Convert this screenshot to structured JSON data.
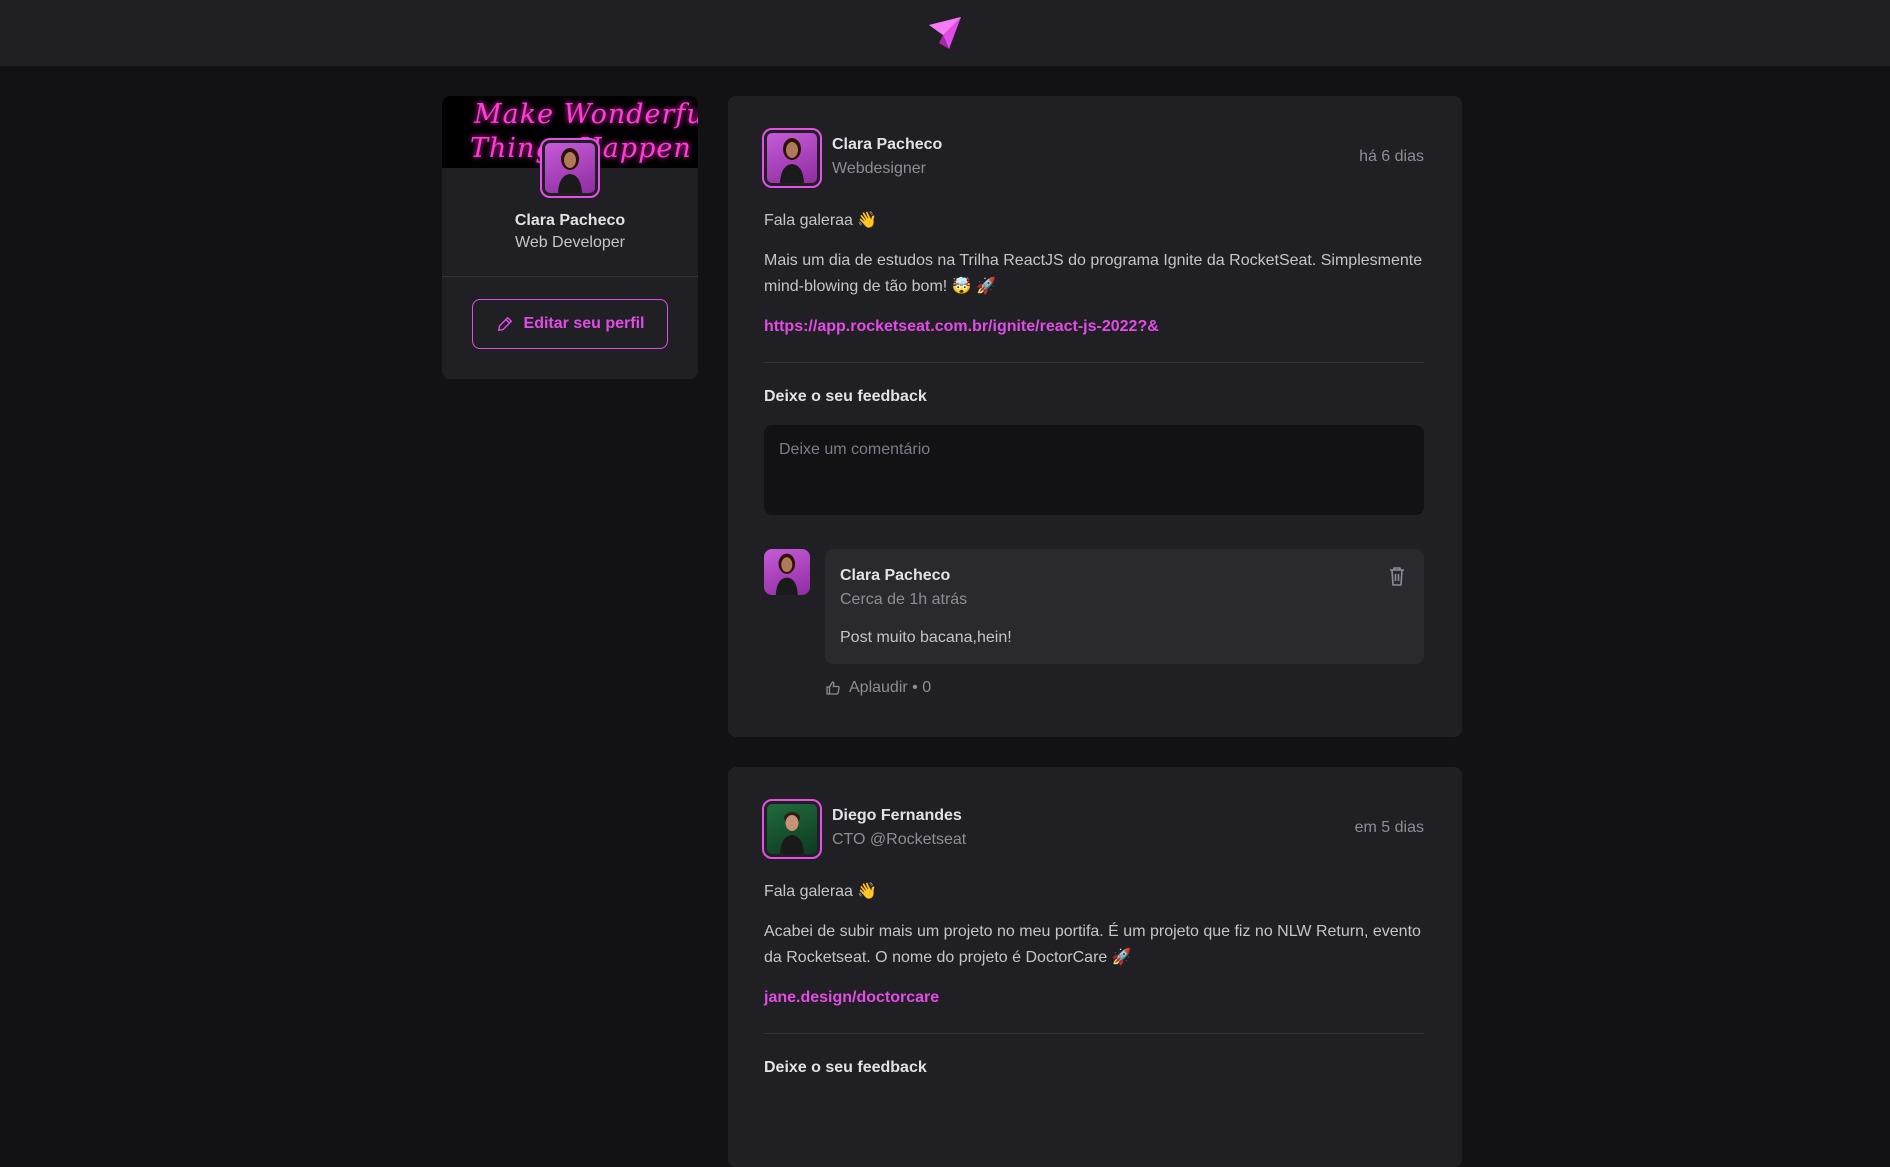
{
  "colors": {
    "accent": "#e24ce6",
    "background": "#121214",
    "surface": "#202024"
  },
  "header": {
    "logo_icon": "ignite-feed-logo-icon"
  },
  "sidebar": {
    "cover_line1": "Make Wonderful",
    "cover_line2": "Things Happen",
    "name": "Clara Pacheco",
    "role": "Web Developer",
    "edit_button_label": "Editar seu perfil",
    "edit_icon": "pencil-icon"
  },
  "posts": [
    {
      "author": "Clara Pacheco",
      "role": "Webdesigner",
      "time": "há 6 dias",
      "greeting": "Fala galeraa 👋",
      "body": "Mais um dia de estudos na Trilha ReactJS do programa Ignite da RocketSeat. Simplesmente mind-blowing de tão bom! 🤯 🚀",
      "link": "https://app.rocketseat.com.br/ignite/react-js-2022?&",
      "feedback_title": "Deixe o seu feedback",
      "comment_placeholder": "Deixe um comentário",
      "comments": [
        {
          "author": "Clara Pacheco",
          "time": "Cerca de 1h atrás",
          "text": "Post muito bacana,hein!",
          "applaud_label": "Aplaudir • 0"
        }
      ]
    },
    {
      "author": "Diego Fernandes",
      "role": "CTO @Rocketseat",
      "time": "em 5 dias",
      "greeting": "Fala galeraa 👋",
      "body": "Acabei de subir mais um projeto no meu portifa. É um projeto que fiz no NLW Return, evento da Rocketseat. O nome do projeto é DoctorCare 🚀",
      "link": "jane.design/doctorcare",
      "feedback_title": "Deixe o seu feedback"
    }
  ]
}
